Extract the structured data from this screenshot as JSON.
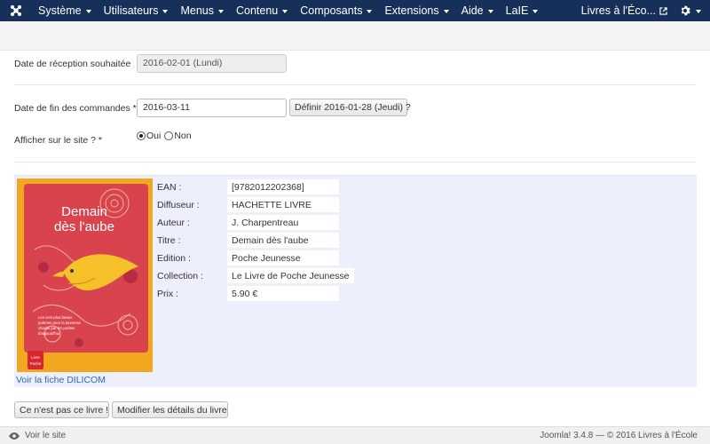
{
  "navbar": {
    "logo_icon": "joomla-logo-icon",
    "menu": [
      {
        "label": "Système"
      },
      {
        "label": "Utilisateurs"
      },
      {
        "label": "Menus"
      },
      {
        "label": "Contenu"
      },
      {
        "label": "Composants"
      },
      {
        "label": "Extensions"
      },
      {
        "label": "Aide"
      },
      {
        "label": "LaIE"
      }
    ],
    "site_label": "Livres à l'Éco...",
    "settings_icon": "gear-icon"
  },
  "form": {
    "reception_label": "Date de réception souhaitée",
    "reception_value": "2016-02-01 (Lundi)",
    "end_label": "Date de fin des commandes *",
    "end_value": "2016-03-11",
    "set_date_button": "Définir 2016-01-28 (Jeudi) ?",
    "show_label": "Afficher sur le site ? *",
    "yes_label": "Oui",
    "no_label": "Non",
    "show_selected": "yes"
  },
  "book": {
    "cover": {
      "title_line1": "Demain",
      "title_line2": "dès l'aube",
      "blurb_line1": "Les cent plus beaux",
      "blurb_line2": "poèmes pour la jeunesse",
      "blurb_line3": "choisis par les poètes",
      "blurb_line4": "d'aujourd'hui",
      "logo_line1": "Livre",
      "logo_line2": "Poche"
    },
    "dilicom_link": "Voir la fiche DILICOM",
    "fields": [
      {
        "label": "EAN :",
        "value": "[9782012202368]"
      },
      {
        "label": "Diffuseur :",
        "value": "HACHETTE LIVRE"
      },
      {
        "label": "Auteur :",
        "value": "J. Charpentreau"
      },
      {
        "label": "Titre :",
        "value": "Demain dès l'aube"
      },
      {
        "label": "Edition :",
        "value": "Poche Jeunesse"
      },
      {
        "label": "Collection :",
        "value": "Le Livre de Poche Jeunesse"
      },
      {
        "label": "Prix :",
        "value": "5.90 €"
      }
    ]
  },
  "actions": {
    "not_this_book": "Ce n'est pas ce livre !",
    "edit_details": "Modifier les détails du livre"
  },
  "footer": {
    "view_site": "Voir le site",
    "credits": "Joomla! 3.4.8  —  © 2016 Livres à l'École"
  },
  "colors": {
    "navbar": "#17305a",
    "panel": "#eeeffd",
    "link": "#2a69b8",
    "cover_bg": "#f2a81e",
    "cover_red": "#d8434e"
  }
}
